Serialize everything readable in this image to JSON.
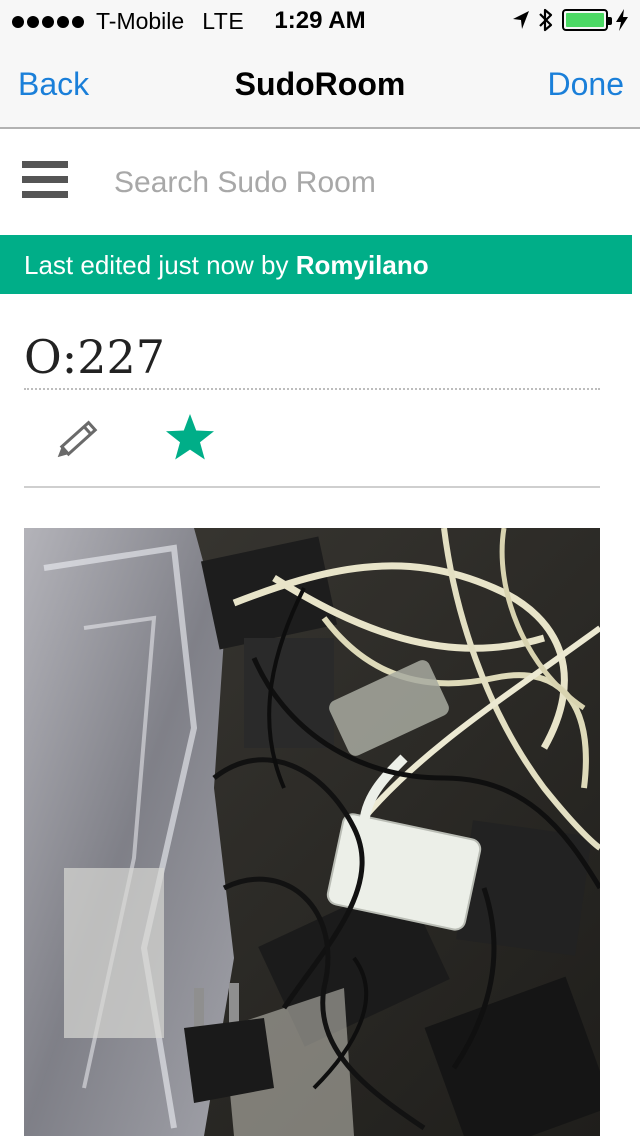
{
  "status_bar": {
    "carrier": "T-Mobile",
    "network": "LTE",
    "time": "1:29 AM",
    "signal_bars": 5,
    "battery_level": 1.0,
    "battery_color": "#4cd964"
  },
  "nav": {
    "back_label": "Back",
    "title": "SudoRoom",
    "done_label": "Done",
    "accent_color": "#1a7fd9"
  },
  "search": {
    "placeholder": "Search Sudo Room",
    "value": ""
  },
  "banner": {
    "prefix": "Last edited just now by ",
    "user": "Romyilano",
    "color": "#00ae88"
  },
  "page": {
    "title": "O:227"
  },
  "icons": {
    "menu": "hamburger-menu-icon",
    "edit": "pencil-icon",
    "favorite": "star-icon"
  }
}
